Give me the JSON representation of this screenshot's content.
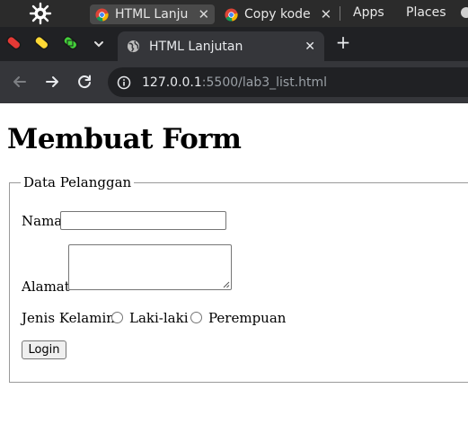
{
  "os_bar": {
    "tabs": [
      {
        "label": "HTML Lanju",
        "close": "✕"
      },
      {
        "label": "Copy kode",
        "close": "✕"
      }
    ],
    "menus": [
      "Apps",
      "Places"
    ]
  },
  "browser": {
    "tab": {
      "title": "HTML Lanjutan",
      "close": "✕"
    },
    "new_tab": "+",
    "tab_list": "⌄",
    "url": {
      "host": "127.0.0.1",
      "rest": ":5500/lab3_list.html"
    }
  },
  "page": {
    "heading": "Membuat Form",
    "legend": "Data Pelanggan",
    "nama_label": "Nama",
    "nama_value": "",
    "alamat_label": "Alamat",
    "alamat_value": "",
    "gender_label": "Jenis Kelamin",
    "gender_options": [
      "Laki-laki",
      "Perempuan"
    ],
    "login_label": "Login"
  }
}
